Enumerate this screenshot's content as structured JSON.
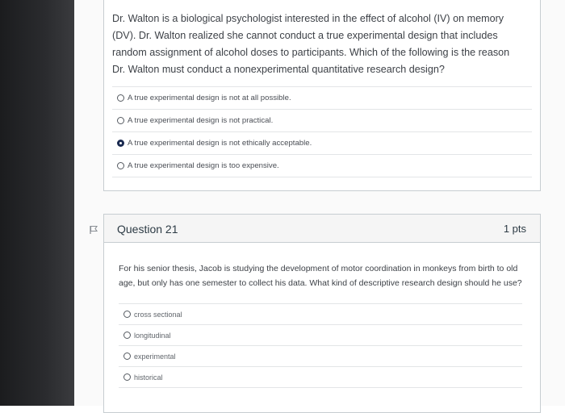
{
  "question20": {
    "text": "Dr. Walton is a biological psychologist interested in the effect of alcohol (IV) on memory (DV). Dr. Walton realized she cannot conduct a true experimental design that includes random assignment of alcohol doses to participants. Which of the following is the reason Dr. Walton must conduct a nonexperimental quantitative research design?",
    "options": [
      {
        "label": "A true experimental design is not at all possible.",
        "selected": false
      },
      {
        "label": "A true experimental design is not practical.",
        "selected": false
      },
      {
        "label": "A true experimental design is not ethically acceptable.",
        "selected": true
      },
      {
        "label": "A true experimental design is too expensive.",
        "selected": false
      }
    ]
  },
  "question21": {
    "title": "Question 21",
    "points": "1 pts",
    "text": "For his senior thesis, Jacob is studying the development of motor coordination in monkeys from birth to old age, but only has one semester to collect his data. What kind of descriptive research design should he use?",
    "options": [
      {
        "label": "cross sectional",
        "selected": false
      },
      {
        "label": "longitudinal",
        "selected": false
      },
      {
        "label": "experimental",
        "selected": false
      },
      {
        "label": "historical",
        "selected": false
      }
    ]
  },
  "colors": {
    "selected_radio": "#1a2a50",
    "card_border": "#c7cdd1",
    "header_bg": "#f5f5f5"
  },
  "icons": {
    "flag": "flag-icon"
  }
}
